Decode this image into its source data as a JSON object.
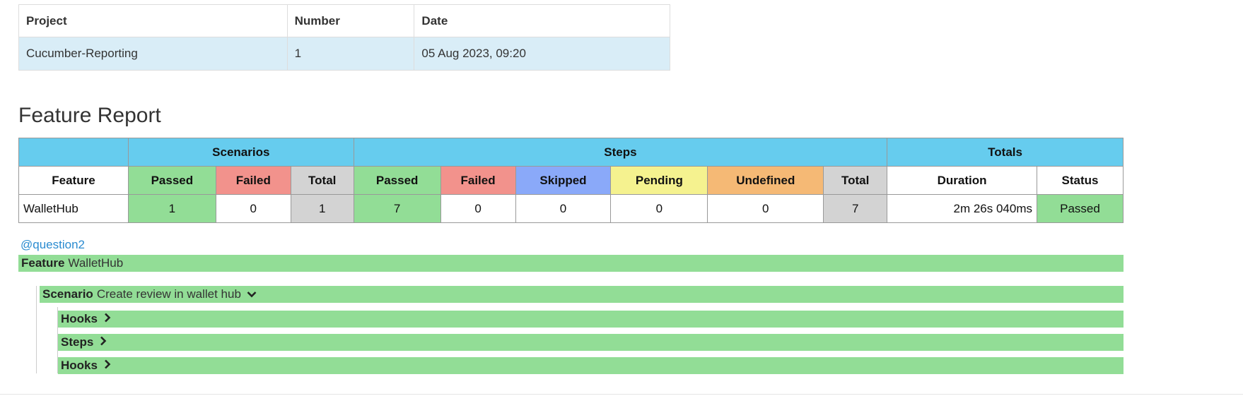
{
  "info": {
    "headers": [
      "Project",
      "Number",
      "Date"
    ],
    "row": [
      "Cucumber-Reporting",
      "1",
      "05 Aug 2023, 09:20"
    ]
  },
  "report": {
    "title": "Feature Report",
    "groups": {
      "scenarios": "Scenarios",
      "steps": "Steps",
      "totals": "Totals"
    },
    "columns": {
      "feature": "Feature",
      "sc_passed": "Passed",
      "sc_failed": "Failed",
      "sc_total": "Total",
      "st_passed": "Passed",
      "st_failed": "Failed",
      "st_skipped": "Skipped",
      "st_pending": "Pending",
      "st_undefined": "Undefined",
      "st_total": "Total",
      "duration": "Duration",
      "status": "Status"
    },
    "row": {
      "feature": "WalletHub",
      "sc_passed": "1",
      "sc_failed": "0",
      "sc_total": "1",
      "st_passed": "7",
      "st_failed": "0",
      "st_skipped": "0",
      "st_pending": "0",
      "st_undefined": "0",
      "st_total": "7",
      "duration": "2m 26s 040ms",
      "status": "Passed"
    }
  },
  "details": {
    "tag": "@question2",
    "feature_keyword": "Feature",
    "feature_name": "WalletHub",
    "scenario_keyword": "Scenario",
    "scenario_name": "Create review in wallet hub",
    "sections": [
      {
        "label": "Hooks"
      },
      {
        "label": "Steps"
      },
      {
        "label": "Hooks"
      }
    ]
  },
  "icons": {
    "scenario_toggle": "chevron-down-icon",
    "section_toggle": "chevron-right-icon"
  },
  "colors": {
    "passed": "#92dd96",
    "failed": "#f2928c",
    "skipped": "#8aa9f9",
    "pending": "#f5f28f",
    "undefined": "#f5b975",
    "total": "#d3d3d3",
    "group_header": "#66ccee",
    "info_row": "#d9edf7",
    "tag": "#2a8bd0"
  }
}
